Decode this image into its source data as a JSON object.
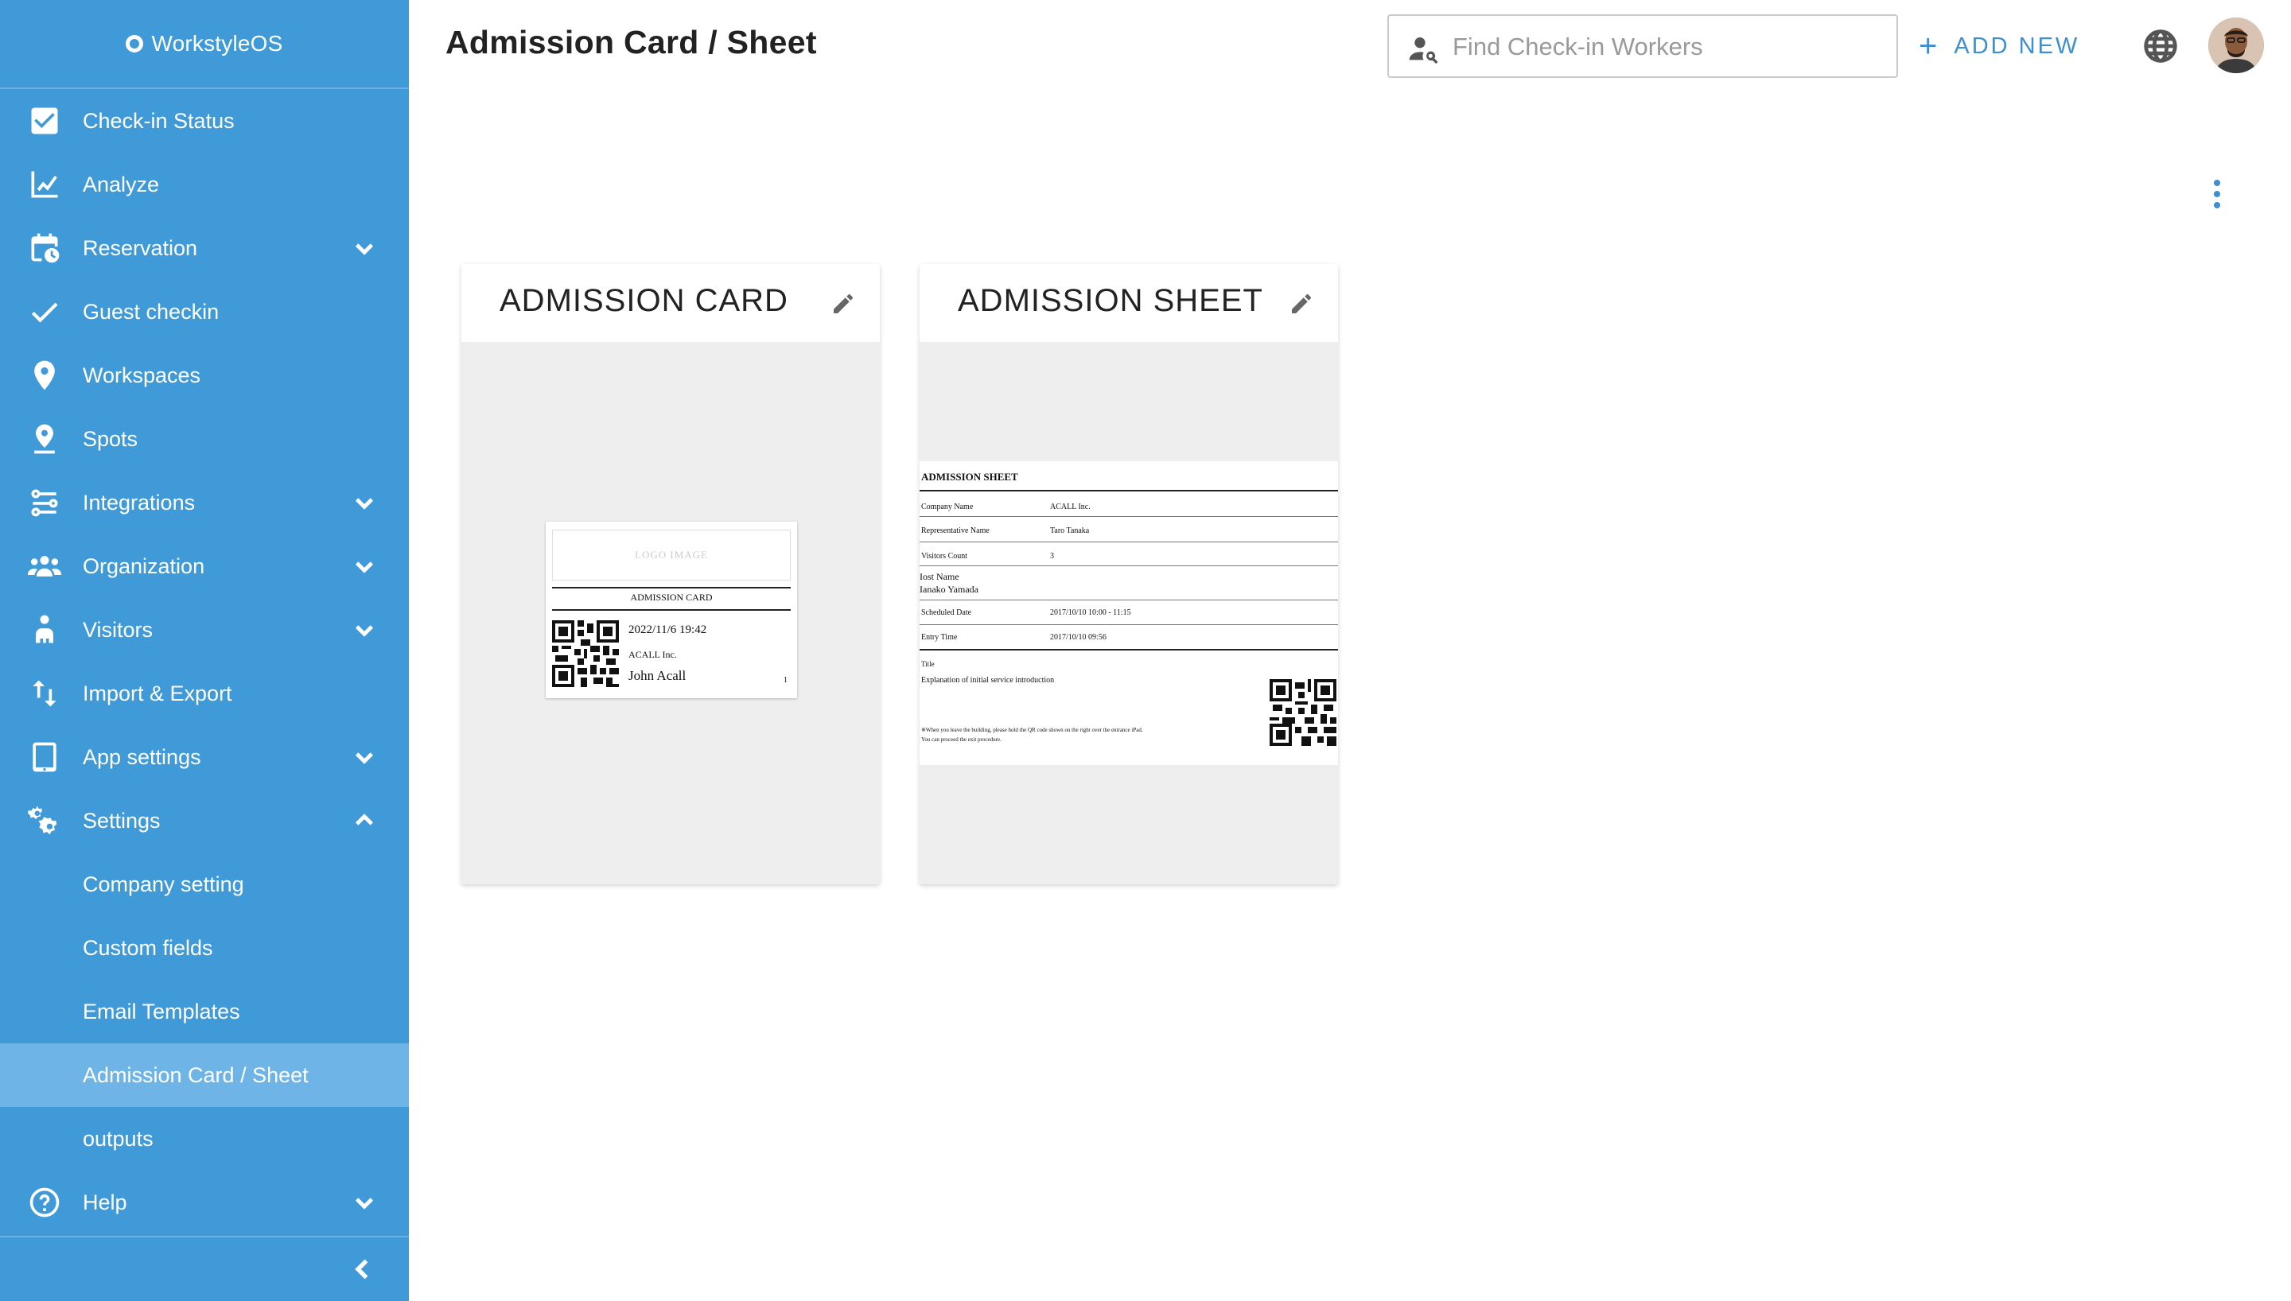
{
  "brand": {
    "name": "WorkstyleOS"
  },
  "colors": {
    "sidebar": "#409ad8",
    "sidebar_active": "#6fb4e6",
    "accent": "#3d8fd1"
  },
  "sidebar": {
    "items": [
      {
        "label": "Check-in Status",
        "icon": "checkbox-icon",
        "expandable": false
      },
      {
        "label": "Analyze",
        "icon": "line-chart-icon",
        "expandable": false
      },
      {
        "label": "Reservation",
        "icon": "calendar-clock-icon",
        "expandable": true,
        "expanded": false
      },
      {
        "label": "Guest checkin",
        "icon": "check-icon",
        "expandable": false
      },
      {
        "label": "Workspaces",
        "icon": "location-pin-icon",
        "expandable": false
      },
      {
        "label": "Spots",
        "icon": "spot-pin-icon",
        "expandable": false
      },
      {
        "label": "Integrations",
        "icon": "integrations-icon",
        "expandable": true,
        "expanded": false
      },
      {
        "label": "Organization",
        "icon": "people-icon",
        "expandable": true,
        "expanded": false
      },
      {
        "label": "Visitors",
        "icon": "visitor-icon",
        "expandable": true,
        "expanded": false
      },
      {
        "label": "Import & Export",
        "icon": "import-export-icon",
        "expandable": false
      },
      {
        "label": "App settings",
        "icon": "tablet-icon",
        "expandable": true,
        "expanded": false
      },
      {
        "label": "Settings",
        "icon": "gears-icon",
        "expandable": true,
        "expanded": true
      },
      {
        "label": "Company setting",
        "sub": true
      },
      {
        "label": "Custom fields",
        "sub": true
      },
      {
        "label": "Email Templates",
        "sub": true
      },
      {
        "label": "Admission Card / Sheet",
        "sub": true,
        "active": true
      },
      {
        "label": "outputs",
        "sub": true
      },
      {
        "label": "Help",
        "icon": "help-icon",
        "expandable": true,
        "expanded": false
      }
    ]
  },
  "header": {
    "title": "Admission Card / Sheet",
    "search_placeholder": "Find Check-in Workers",
    "add_new_label": "ADD NEW"
  },
  "cards": [
    {
      "title": "ADMISSION CARD"
    },
    {
      "title": "ADMISSION SHEET"
    }
  ],
  "admission_card_preview": {
    "logo_placeholder": "LOGO IMAGE",
    "title": "ADMISSION CARD",
    "datetime": "2022/11/6 19:42",
    "company": "ACALL Inc.",
    "name": "John Acall",
    "number": "1"
  },
  "admission_sheet_preview": {
    "title": "ADMISSION SHEET",
    "rows": [
      {
        "label": "Company Name",
        "value": "ACALL Inc."
      },
      {
        "label": "Representative Name",
        "value": "Taro Tanaka"
      },
      {
        "label": "Visitors Count",
        "value": "3"
      },
      {
        "label": "Scheduled Date",
        "value": "2017/10/10 10:00 - 11:15"
      },
      {
        "label": "Entry Time",
        "value": "2017/10/10 09:56"
      }
    ],
    "host_label": "Iost Name",
    "host_value": "Ianako Yamada",
    "block_title": "Title",
    "block_text": "Explanation of initial service introduction",
    "note_line1": "※When you leave the building, please hold the QR code shown on the right over the entrance iPad.",
    "note_line2": "You can proceed the exit procedure."
  }
}
